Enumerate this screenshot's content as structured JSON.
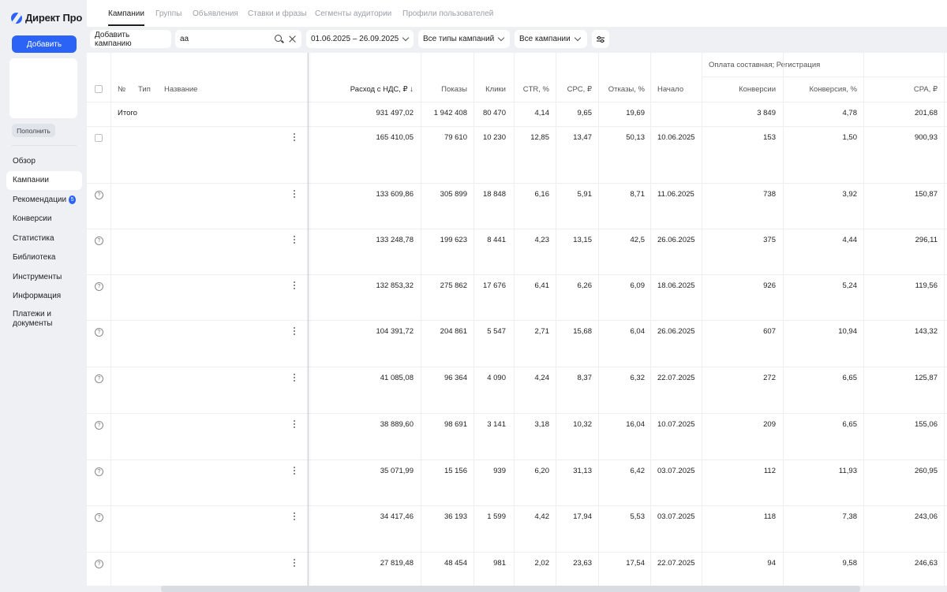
{
  "app": {
    "logo_text": "Директ Про"
  },
  "sidebar": {
    "add_label": "Добавить",
    "topup_label": "Пополнить",
    "items": [
      {
        "label": "Обзор"
      },
      {
        "label": "Кампании"
      },
      {
        "label": "Рекомендации",
        "badge": "5"
      },
      {
        "label": "Конверсии"
      },
      {
        "label": "Статистика"
      },
      {
        "label": "Библиотека"
      },
      {
        "label": "Инструменты"
      },
      {
        "label": "Информация"
      },
      {
        "label": "Платежи и документы"
      }
    ]
  },
  "tabs": [
    "Кампании",
    "Группы",
    "Объявления",
    "Ставки и фразы",
    "Сегменты аудитории",
    "Профили пользователей"
  ],
  "filters": {
    "add_campaign": "Добавить кампанию",
    "search_value": "aa",
    "date_range": "01.06.2025 – 26.09.2025",
    "types": "Все типы кампаний",
    "campaigns": "Все кампании"
  },
  "table": {
    "group_header": "Оплата составная; Регистрация",
    "headers": {
      "num": "№",
      "type": "Тип",
      "name": "Название",
      "spend": "Расход с НДС, ₽ ↓",
      "impressions": "Показы",
      "clicks": "Клики",
      "ctr": "CTR, %",
      "cpc": "CPC, ₽",
      "bounce": "Отказы, %",
      "start": "Начало",
      "conversions": "Конверсии",
      "conv_rate": "Конверсия, %",
      "cpa": "CPA, ₽"
    },
    "total": {
      "label": "Итого",
      "spend": "931 497,02",
      "impressions": "1 942 408",
      "clicks": "80 470",
      "ctr": "4,14",
      "cpc": "9,65",
      "bounce": "19,69",
      "conversions": "3 849",
      "conv_rate": "4,78",
      "cpa": "201,68"
    },
    "rows": [
      {
        "spend": "165 410,05",
        "impressions": "79 610",
        "clicks": "10 230",
        "ctr": "12,85",
        "cpc": "13,47",
        "bounce": "50,13",
        "start": "10.06.2025",
        "conversions": "153",
        "conv_rate": "1,50",
        "cpa": "900,93"
      },
      {
        "spend": "133 609,86",
        "impressions": "305 899",
        "clicks": "18 848",
        "ctr": "6,16",
        "cpc": "5,91",
        "bounce": "8,71",
        "start": "11.06.2025",
        "conversions": "738",
        "conv_rate": "3,92",
        "cpa": "150,87"
      },
      {
        "spend": "133 248,78",
        "impressions": "199 623",
        "clicks": "8 441",
        "ctr": "4,23",
        "cpc": "13,15",
        "bounce": "42,5",
        "start": "26.06.2025",
        "conversions": "375",
        "conv_rate": "4,44",
        "cpa": "296,11"
      },
      {
        "spend": "132 853,32",
        "impressions": "275 862",
        "clicks": "17 676",
        "ctr": "6,41",
        "cpc": "6,26",
        "bounce": "6,09",
        "start": "18.06.2025",
        "conversions": "926",
        "conv_rate": "5,24",
        "cpa": "119,56"
      },
      {
        "spend": "104 391,72",
        "impressions": "204 861",
        "clicks": "5 547",
        "ctr": "2,71",
        "cpc": "15,68",
        "bounce": "6,04",
        "start": "26.06.2025",
        "conversions": "607",
        "conv_rate": "10,94",
        "cpa": "143,32"
      },
      {
        "spend": "41 085,08",
        "impressions": "96 364",
        "clicks": "4 090",
        "ctr": "4,24",
        "cpc": "8,37",
        "bounce": "6,32",
        "start": "22.07.2025",
        "conversions": "272",
        "conv_rate": "6,65",
        "cpa": "125,87"
      },
      {
        "spend": "38 889,60",
        "impressions": "98 691",
        "clicks": "3 141",
        "ctr": "3,18",
        "cpc": "10,32",
        "bounce": "16,04",
        "start": "10.07.2025",
        "conversions": "209",
        "conv_rate": "6,65",
        "cpa": "155,06"
      },
      {
        "spend": "35 071,99",
        "impressions": "15 156",
        "clicks": "939",
        "ctr": "6,20",
        "cpc": "31,13",
        "bounce": "6,42",
        "start": "03.07.2025",
        "conversions": "112",
        "conv_rate": "11,93",
        "cpa": "260,95"
      },
      {
        "spend": "34 417,46",
        "impressions": "36 193",
        "clicks": "1 599",
        "ctr": "4,42",
        "cpc": "17,94",
        "bounce": "5,53",
        "start": "03.07.2025",
        "conversions": "118",
        "conv_rate": "7,38",
        "cpa": "243,06"
      },
      {
        "spend": "27 819,48",
        "impressions": "48 454",
        "clicks": "981",
        "ctr": "2,02",
        "cpc": "23,63",
        "bounce": "17,54",
        "start": "22.07.2025",
        "conversions": "94",
        "conv_rate": "9,58",
        "cpa": "246,63"
      }
    ]
  }
}
